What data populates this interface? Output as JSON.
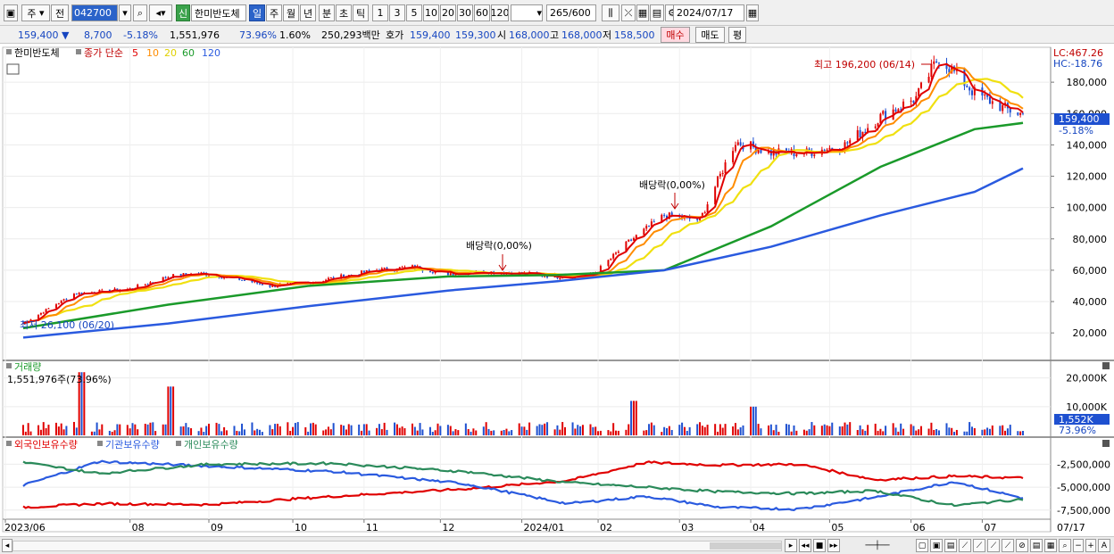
{
  "toolbar": {
    "market": "주",
    "prev": "전",
    "code": "042700",
    "new_badge": "신",
    "stock_name": "한미반도체",
    "periods": [
      "일",
      "주",
      "월",
      "년",
      "분",
      "초",
      "틱"
    ],
    "intervals": [
      "1",
      "3",
      "5",
      "10",
      "20",
      "30",
      "60",
      "120"
    ],
    "count": "265",
    "count_total": "/600",
    "date": "2024/07/17"
  },
  "infobar": {
    "price": "159,400 ▼",
    "change": "8,700",
    "change_pct": "-5.18%",
    "volume": "1,551,976",
    "turnover_pct": "73.96%",
    "pct2": "1.60%",
    "amount": "250,293백만",
    "quote_label": "호가",
    "ask": "159,400",
    "bid": "159,300",
    "open_label": "시",
    "open": "168,000",
    "high_label": "고",
    "high": "168,000",
    "low_label": "저",
    "low": "158,500",
    "buy": "매수",
    "sell": "매도",
    "eval": "평"
  },
  "colors": {
    "up": "#e00000",
    "down": "#1e50d0",
    "ma5": "#e00000",
    "ma10": "#ff8c00",
    "ma20": "#f0e010",
    "ma60": "#1a9a2a",
    "ma120": "#2a5adf",
    "foreign": "#e00000",
    "institution": "#2a5adf",
    "individual": "#2a8a5a"
  },
  "chart_data": [
    {
      "type": "line",
      "panel": "price",
      "legend_title": "한미반도체",
      "legend_label": "종가 단순",
      "ma_periods": [
        "5",
        "10",
        "20",
        "60",
        "120"
      ],
      "y_ticks": [
        20000,
        40000,
        60000,
        80000,
        100000,
        120000,
        140000,
        160000,
        180000
      ],
      "y_tick_labels": [
        "20,000",
        "40,000",
        "60,000",
        "80,000",
        "100,000",
        "120,000",
        "140,000",
        "160,000",
        "180,000"
      ],
      "ylim": [
        7000,
        200000
      ],
      "x_ticks": [
        "2023/06",
        "08",
        "09",
        "10",
        "11",
        "12",
        "2024/01",
        "02",
        "03",
        "04",
        "05",
        "06",
        "07",
        "07/17"
      ],
      "lc_label": "LC:467.26",
      "hc_label": "HC:-18.76",
      "last_price": "159,400",
      "last_change": "-5.18%",
      "max_annotation": "최고 196,200 (06/14)",
      "min_annotation": "최저 26,100 (06/20)",
      "dividend_annotations": [
        "배당락(0,00%)",
        "배당락(0,00%)"
      ],
      "series": [
        {
          "name": "종가",
          "x": [
            "2023-06-20",
            "2023-07-10",
            "2023-08-01",
            "2023-08-16",
            "2023-08-28",
            "2023-09-11",
            "2023-09-25",
            "2023-10-10",
            "2023-10-23",
            "2023-11-06",
            "2023-11-20",
            "2023-12-04",
            "2023-12-18",
            "2024-01-02",
            "2024-01-16",
            "2024-01-30",
            "2024-02-13",
            "2024-02-27",
            "2024-03-12",
            "2024-03-26",
            "2024-04-09",
            "2024-04-23",
            "2024-05-08",
            "2024-05-22",
            "2024-06-05",
            "2024-06-14",
            "2024-06-28",
            "2024-07-10",
            "2024-07-17"
          ],
          "values": [
            26100,
            45000,
            48000,
            56000,
            58000,
            55000,
            50000,
            52000,
            56000,
            60000,
            62000,
            58000,
            59000,
            58000,
            56000,
            57000,
            78000,
            95000,
            92000,
            142000,
            135000,
            135000,
            140000,
            158000,
            170000,
            196200,
            173000,
            163000,
            159400
          ]
        },
        {
          "name": "60",
          "x": [
            "2023-06-20",
            "2023-08-16",
            "2023-10-10",
            "2023-12-04",
            "2024-01-16",
            "2024-02-27",
            "2024-04-09",
            "2024-05-22",
            "2024-06-28",
            "2024-07-17"
          ],
          "values": [
            23000,
            38000,
            50000,
            56000,
            57000,
            60000,
            88000,
            126000,
            150000,
            154000
          ]
        },
        {
          "name": "120",
          "x": [
            "2023-06-20",
            "2023-08-16",
            "2023-10-10",
            "2023-12-04",
            "2024-01-16",
            "2024-02-27",
            "2024-04-09",
            "2024-05-22",
            "2024-06-28",
            "2024-07-17"
          ],
          "values": [
            17000,
            26000,
            37000,
            47000,
            53000,
            60000,
            75000,
            95000,
            110000,
            125000
          ]
        }
      ]
    },
    {
      "type": "bar",
      "panel": "volume",
      "legend_label": "거래량",
      "value_label": "1,551,976주(73.96%)",
      "y_tick_labels": [
        "20,000K",
        "10,000K"
      ],
      "y_ticks": [
        20000,
        10000
      ],
      "ylim": [
        0,
        23000
      ],
      "last_label": "1,552K",
      "last_pct": "73.96%",
      "spikes": [
        {
          "x": "2023-07-13",
          "value": 22000
        },
        {
          "x": "2023-08-17",
          "value": 17000
        },
        {
          "x": "2024-02-15",
          "value": 12000
        },
        {
          "x": "2024-04-02",
          "value": 10000
        }
      ],
      "last_value": 1552
    },
    {
      "type": "line",
      "panel": "holdings",
      "legend_labels": [
        "외국인보유수량",
        "기관보유수량",
        "개인보유수량"
      ],
      "y_ticks": [
        -2500000,
        -5000000,
        -7500000
      ],
      "y_tick_labels": [
        "-2,500,000",
        "-5,000,000",
        "-7,500,000"
      ],
      "ylim": [
        -8300000,
        -1100000
      ],
      "series": [
        {
          "name": "외국인보유수량",
          "x": [
            "2023-06-20",
            "2023-07-20",
            "2023-09-01",
            "2023-10-20",
            "2023-12-10",
            "2024-01-20",
            "2024-02-20",
            "2024-03-20",
            "2024-04-20",
            "2024-05-20",
            "2024-06-20",
            "2024-07-17"
          ],
          "values": [
            -7200000,
            -6800000,
            -6900000,
            -6000000,
            -5200000,
            -4300000,
            -2300000,
            -2600000,
            -2500000,
            -4200000,
            -3800000,
            -4000000
          ]
        },
        {
          "name": "기관보유수량",
          "x": [
            "2023-06-20",
            "2023-07-20",
            "2023-09-01",
            "2023-10-20",
            "2023-12-10",
            "2024-01-20",
            "2024-02-20",
            "2024-03-20",
            "2024-04-20",
            "2024-05-20",
            "2024-06-20",
            "2024-07-17"
          ],
          "values": [
            -4800000,
            -2200000,
            -2700000,
            -3300000,
            -4600000,
            -6800000,
            -6000000,
            -7200000,
            -7400000,
            -6100000,
            -4400000,
            -6200000
          ]
        },
        {
          "name": "개인보유수량",
          "x": [
            "2023-06-20",
            "2023-07-20",
            "2023-09-01",
            "2023-10-20",
            "2023-12-10",
            "2024-01-20",
            "2024-02-20",
            "2024-03-20",
            "2024-04-20",
            "2024-05-20",
            "2024-06-20",
            "2024-07-17"
          ],
          "values": [
            -2300000,
            -3500000,
            -2500000,
            -2400000,
            -3300000,
            -4500000,
            -5000000,
            -5500000,
            -5700000,
            -5400000,
            -7000000,
            -6300000
          ]
        }
      ]
    }
  ]
}
